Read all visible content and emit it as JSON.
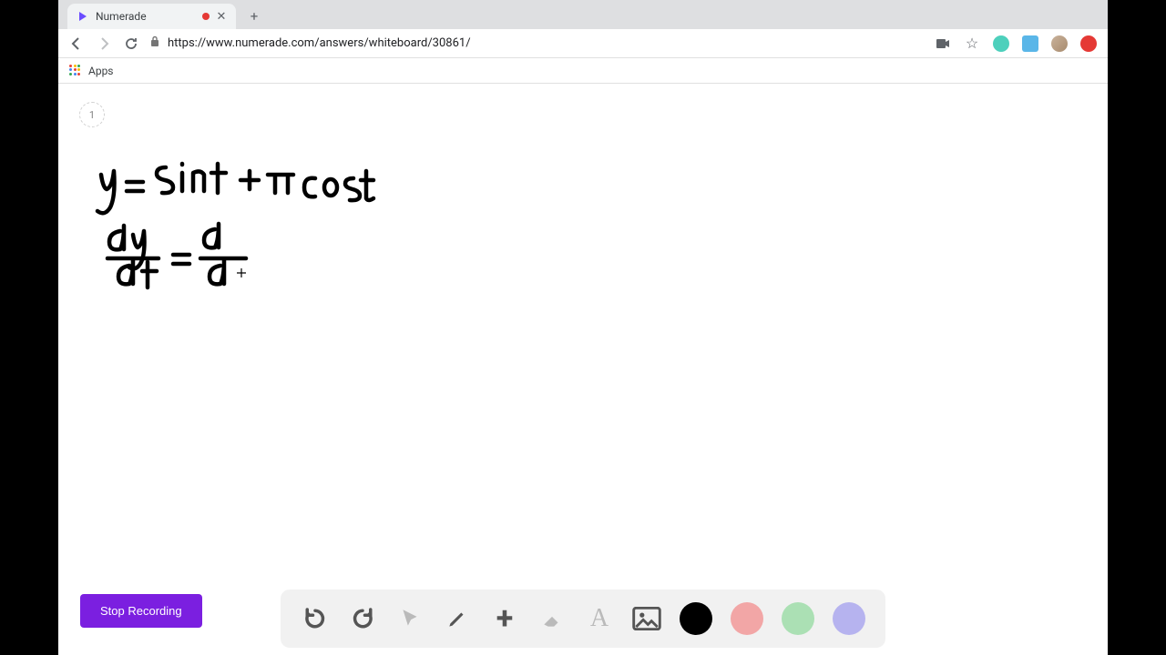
{
  "browser": {
    "tab": {
      "title": "Numerade"
    },
    "url": "https://www.numerade.com/answers/whiteboard/30861/",
    "bookmark_apps": "Apps"
  },
  "whiteboard": {
    "page_number": "1",
    "equations": [
      "y = sin t + π cos t",
      "dy/dt = d/dt"
    ]
  },
  "controls": {
    "stop_recording": "Stop Recording"
  },
  "toolbar": {
    "tools": [
      {
        "name": "undo",
        "enabled": true
      },
      {
        "name": "redo",
        "enabled": true
      },
      {
        "name": "pointer",
        "enabled": false
      },
      {
        "name": "pencil",
        "enabled": true
      },
      {
        "name": "add",
        "enabled": true
      },
      {
        "name": "eraser",
        "enabled": false
      },
      {
        "name": "text",
        "enabled": false
      },
      {
        "name": "image",
        "enabled": true
      }
    ],
    "colors": [
      "#000000",
      "#f2a6a6",
      "#abe0b4",
      "#b6b3ef"
    ]
  }
}
